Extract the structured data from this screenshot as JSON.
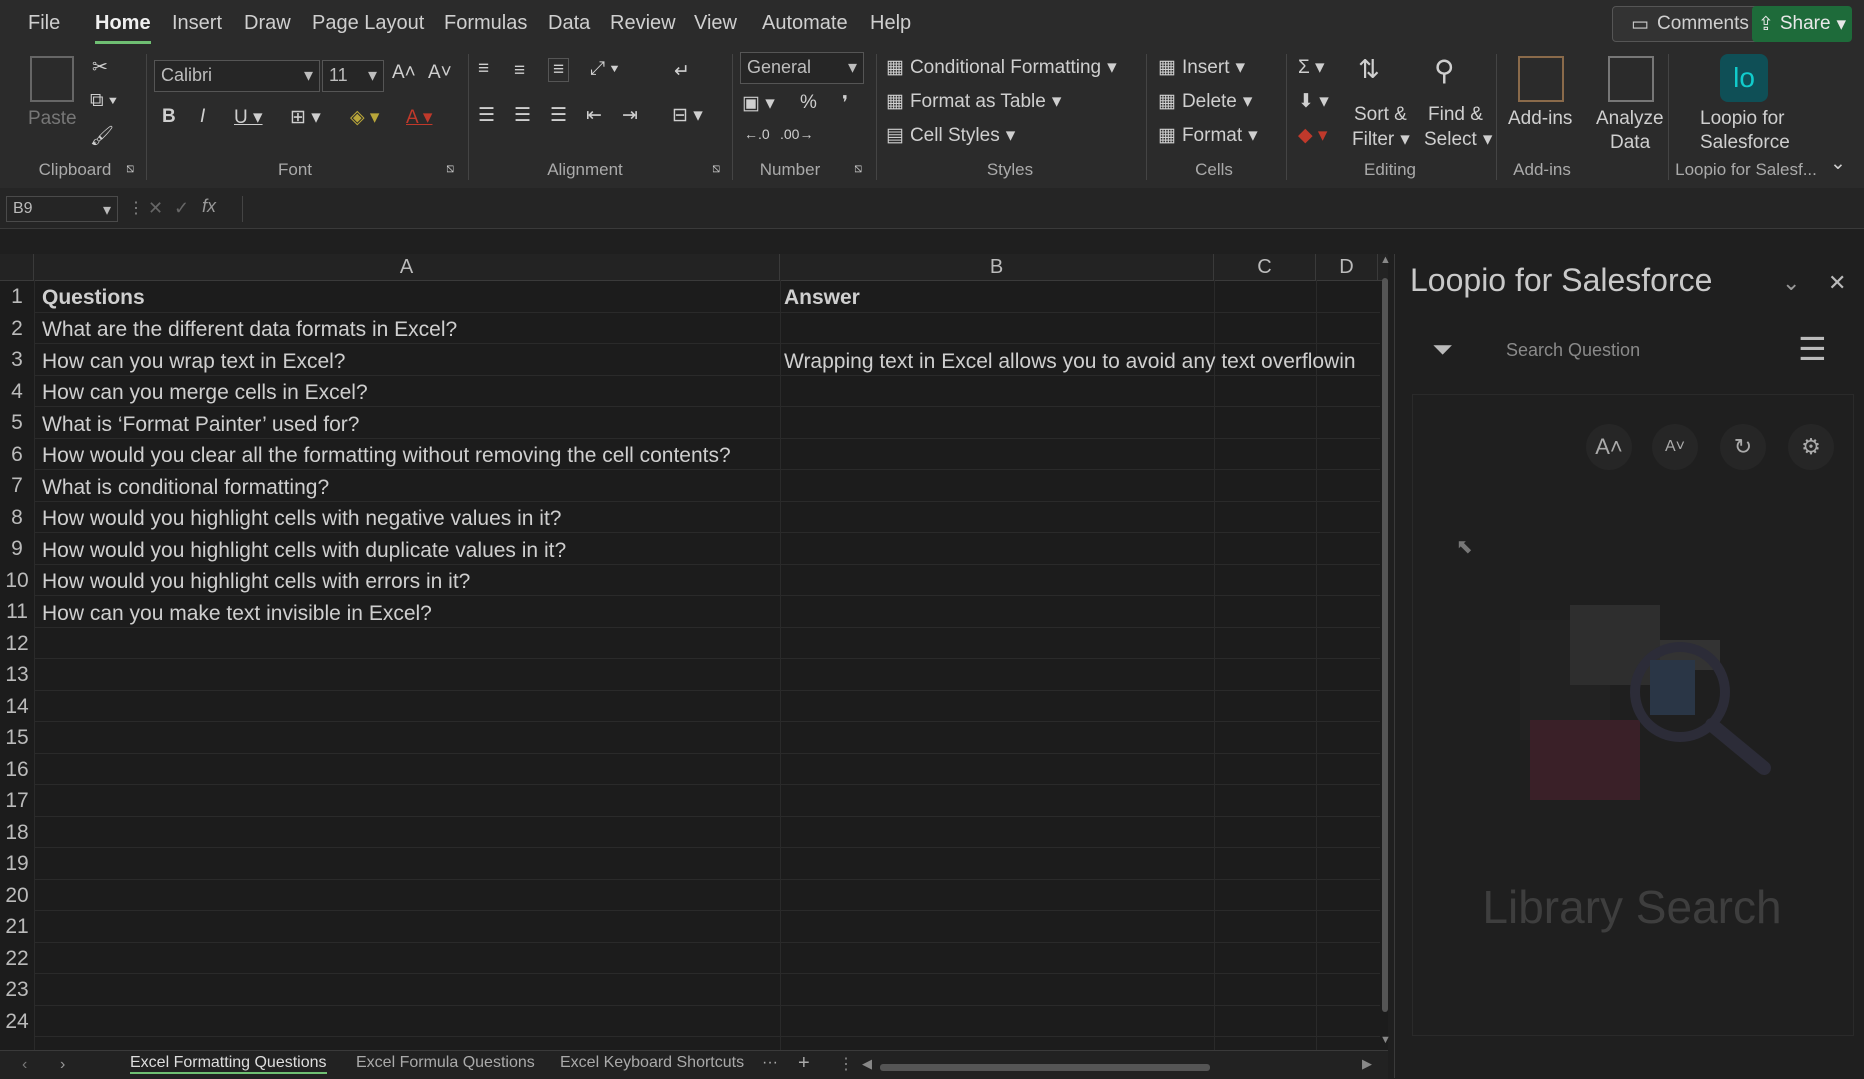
{
  "menu": {
    "items": [
      "File",
      "Home",
      "Insert",
      "Draw",
      "Page Layout",
      "Formulas",
      "Data",
      "Review",
      "View",
      "Automate",
      "Help"
    ],
    "active": "Home",
    "comments_label": "Comments",
    "share_label": "Share"
  },
  "ribbon": {
    "clipboard": {
      "paste_label": "Paste",
      "group_label": "Clipboard"
    },
    "font": {
      "font_name": "Calibri",
      "font_size": "11",
      "group_label": "Font"
    },
    "alignment": {
      "group_label": "Alignment"
    },
    "number": {
      "format": "General",
      "group_label": "Number"
    },
    "styles": {
      "conditional_formatting": "Conditional Formatting",
      "format_as_table": "Format as Table",
      "cell_styles": "Cell Styles",
      "group_label": "Styles"
    },
    "cells": {
      "insert": "Insert",
      "delete": "Delete",
      "format": "Format",
      "group_label": "Cells"
    },
    "editing": {
      "sort_filter_1": "Sort &",
      "sort_filter_2": "Filter",
      "find_select_1": "Find &",
      "find_select_2": "Select",
      "group_label": "Editing"
    },
    "addins": {
      "addins_label": "Add-ins",
      "analyze_1": "Analyze",
      "analyze_2": "Data",
      "group_label": "Add-ins"
    },
    "loopio": {
      "label_1": "Loopio for",
      "label_2": "Salesforce",
      "group_label": "Loopio for Salesf..."
    }
  },
  "formula_bar": {
    "name_box": "B9",
    "fx": "fx"
  },
  "grid": {
    "columns": [
      "A",
      "B",
      "C",
      "D"
    ],
    "rows": [
      "1",
      "2",
      "3",
      "4",
      "5",
      "6",
      "7",
      "8",
      "9",
      "10",
      "11",
      "12",
      "13",
      "14",
      "15",
      "16",
      "17",
      "18",
      "19",
      "20",
      "21",
      "22",
      "23",
      "24"
    ],
    "header_a": "Questions",
    "header_b": "Answer",
    "questions": [
      "What are the different data formats in Excel?",
      "How can you wrap text in Excel?",
      "How can you merge cells in Excel?",
      "What is ‘Format Painter’ used for?",
      "How would you clear all the formatting without removing the cell contents?",
      "What is conditional formatting?",
      "How would you highlight cells with negative values in it?",
      "How would you highlight cells with duplicate values in it?",
      "How would you highlight cells with errors in it?",
      "How can you make text invisible in Excel?"
    ],
    "answer_row3": "Wrapping text in Excel allows you to avoid any text overflowin"
  },
  "sheet_tabs": {
    "tabs": [
      "Excel Formatting Questions",
      "Excel Formula Questions",
      "Excel Keyboard Shortcuts"
    ],
    "active": "Excel Formatting Questions"
  },
  "panel": {
    "title": "Loopio for Salesforce",
    "search_placeholder": "Search Question",
    "library_search": "Library Search"
  }
}
